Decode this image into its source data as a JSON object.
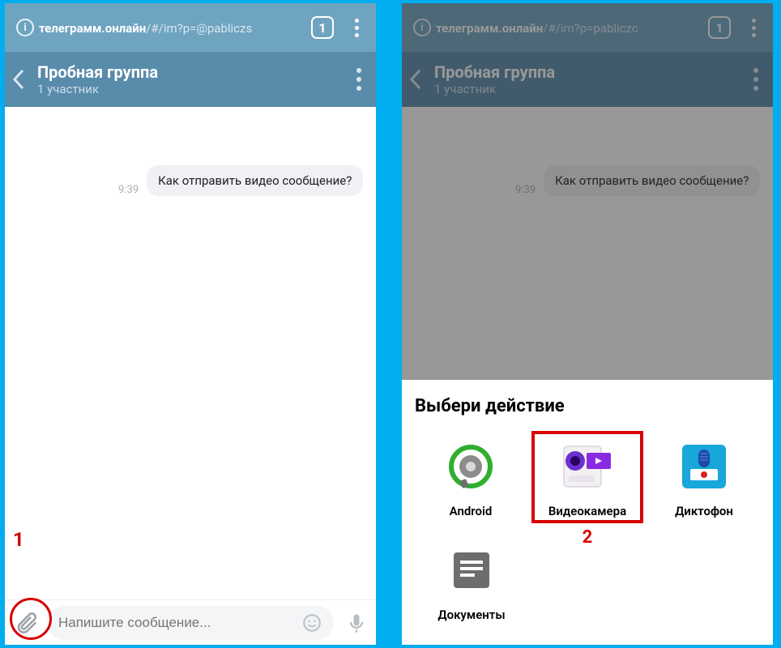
{
  "browser": {
    "url_bold": "телеграмм.онлайн",
    "url_rest_left": "/#/im?p=@pabliczs",
    "url_rest_right": "/#/im?p=pabliczc",
    "tabs": "1"
  },
  "chat": {
    "title": "Пробная группа",
    "subtitle": "1 участник"
  },
  "message": {
    "time": "9:39",
    "text": "Как отправить видео сообщение?"
  },
  "input": {
    "placeholder": "Напишите сообщение..."
  },
  "callouts": {
    "one": "1",
    "two": "2"
  },
  "sheet": {
    "title": "Выбери действие",
    "actions": {
      "android": "Android",
      "camera": "Видеокамера",
      "recorder": "Диктофон",
      "documents": "Документы"
    }
  }
}
